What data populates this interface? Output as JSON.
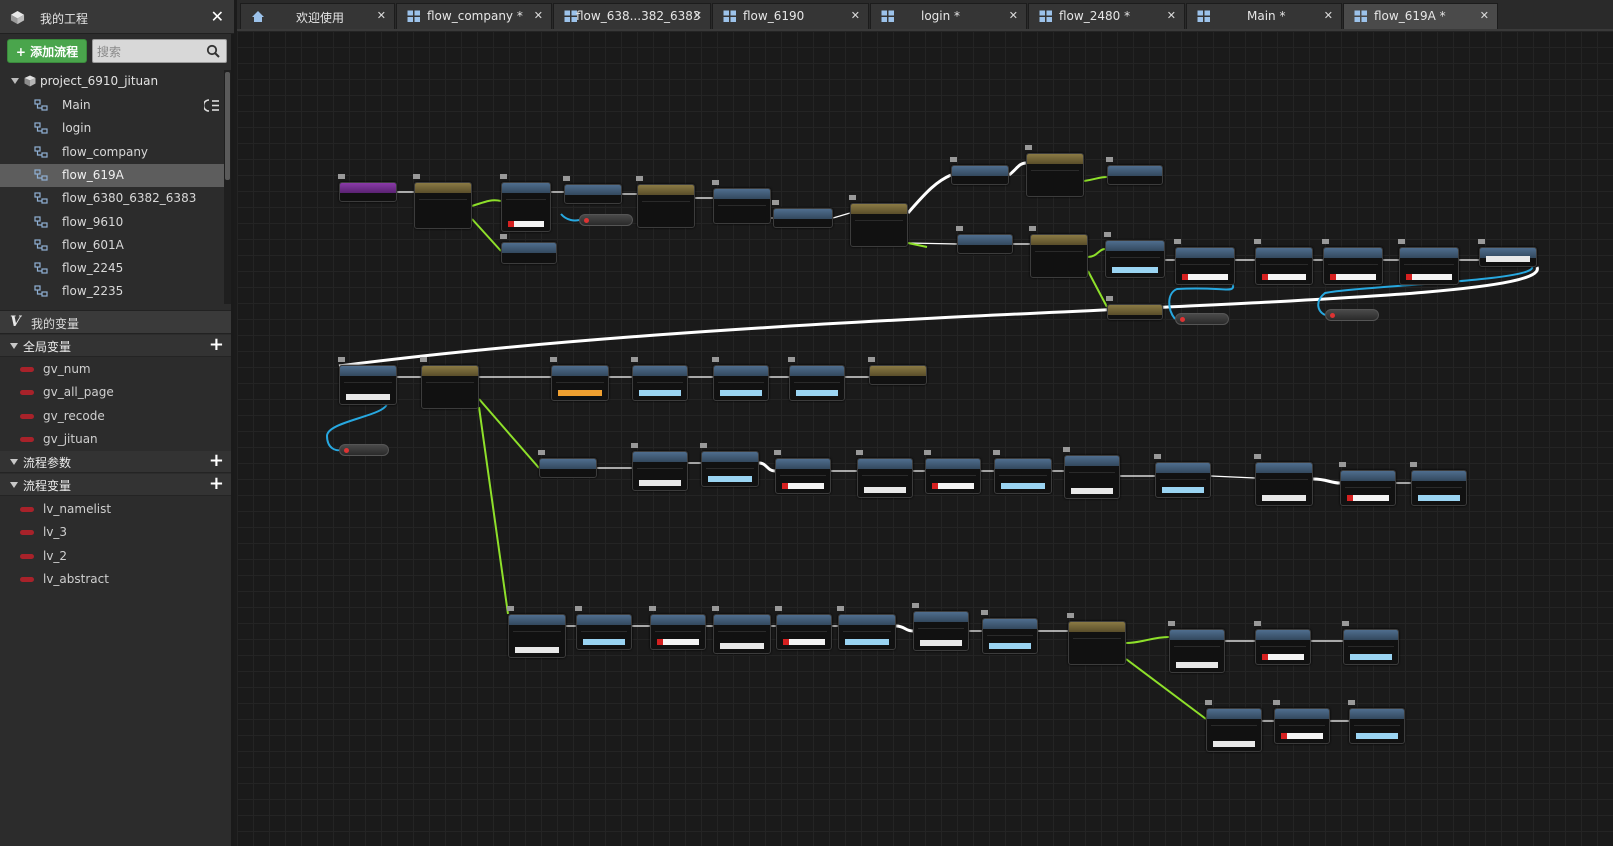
{
  "sidebar": {
    "title": "我的工程",
    "add_button": "+ 添加流程",
    "search_placeholder": "搜索",
    "project": "project_6910_jituan",
    "flows": [
      "Main",
      "login",
      "flow_company",
      "flow_619A",
      "flow_6380_6382_6383",
      "flow_9610",
      "flow_601A",
      "flow_2245",
      "flow_2235"
    ],
    "active_flow": "flow_619A",
    "vars_title": "我的变量",
    "global_vars_title": "全局变量",
    "global_vars": [
      "gv_num",
      "gv_all_page",
      "gv_recode",
      "gv_jituan"
    ],
    "flow_params_title": "流程参数",
    "flow_vars_title": "流程变量",
    "flow_vars": [
      "lv_namelist",
      "lv_3",
      "lv_2",
      "lv_abstract"
    ]
  },
  "tabs": [
    {
      "label": "欢迎使用",
      "icon": "home-icon"
    },
    {
      "label": "flow_company  *",
      "icon": "flow-icon"
    },
    {
      "label": "flow_638...382_6383",
      "icon": "flow-icon"
    },
    {
      "label": "flow_6190",
      "icon": "flow-icon"
    },
    {
      "label": "login  *",
      "icon": "flow-icon"
    },
    {
      "label": "flow_2480  *",
      "icon": "flow-icon"
    },
    {
      "label": "Main  *",
      "icon": "flow-icon"
    },
    {
      "label": "flow_619A  *",
      "icon": "flow-icon"
    }
  ],
  "active_tab": "flow_619A  *",
  "colors": {
    "add_button": "#4aa54c",
    "active_tree_item": "#5d5d5d",
    "exec_wire": "#ffffff",
    "true_wire": "#8ee02a",
    "data_wire": "#27a8e0",
    "variable": "#a8222a"
  }
}
